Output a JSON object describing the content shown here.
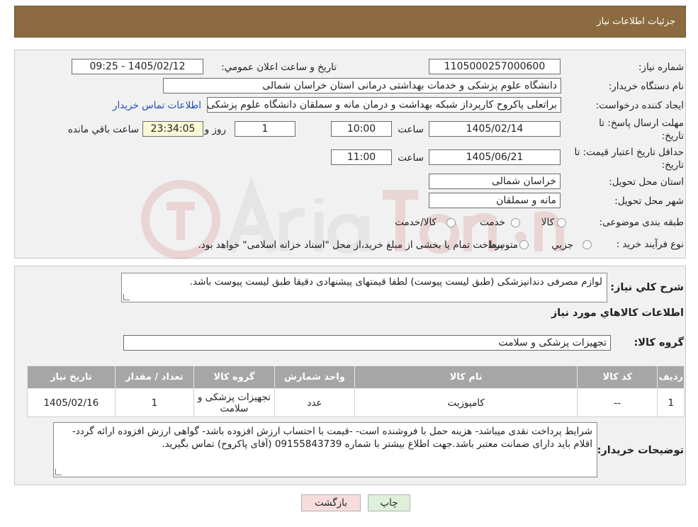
{
  "header": {
    "title": "جزئیات اطلاعات نیاز"
  },
  "form": {
    "need_number_label": "شماره نیاز:",
    "need_number": "1105000257000600",
    "announce_label": "تاریخ و ساعت اعلان عمومي:",
    "announce_value": "1405/02/12 - 09:25",
    "buyer_label": "نام دستگاه خریدار:",
    "buyer_value": "دانشگاه علوم پزشکی و خدمات بهداشتی درمانی استان خراسان شمالی",
    "creator_label": "ایجاد کننده درخواست:",
    "creator_value": "براتعلی پاکروح کارپرداز شبکه بهداشت و درمان مانه و سملقان دانشگاه علوم پزشکی",
    "contact_link": "اطلاعات تماس خریدار",
    "deadline_label_1": "مهلت ارسال پاسخ: تا",
    "deadline_label_2": "تاریخ:",
    "deadline_date": "1405/02/14",
    "time_label": "ساعت",
    "deadline_time": "10:00",
    "days_value": "1",
    "days_label": "روز و",
    "remaining_time": "23:34:05",
    "remaining_label": "ساعت باقي مانده",
    "validity_label_1": "حداقل تاریخ اعتبار قیمت: تا",
    "validity_label_2": "تاریخ:",
    "validity_date": "1405/06/21",
    "validity_time": "11:00",
    "province_label": "استان محل تحویل:",
    "province_value": "خراسان شمالی",
    "city_label": "شهر محل تحویل:",
    "city_value": "مانه و سملقان",
    "category_label": "طبقه بندی موضوعی:",
    "category_options": [
      "کالا",
      "خدمت",
      "کالا/خدمت"
    ],
    "process_label": "نوع فرآیند خرید :",
    "process_options": [
      "جزیي",
      "متوسط"
    ],
    "process_note": "پرداخت تمام یا بخشی از مبلغ خرید،از محل \"اسناد خزانه اسلامی\" خواهد بود."
  },
  "details": {
    "summary_label": "شرح کلي نیاز:",
    "summary_value": "لوازم مصرفی دندانپزشکی (طبق لیست پیوست) لطفا قیمتهای پیشنهادی دقیقا طبق لیست پیوست باشد.",
    "goods_info_title": "اطلاعات کالاهاي مورد نیاز",
    "goods_group_label": "گروه کالا:",
    "goods_group_value": "تجهیزات پزشکی و سلامت",
    "table": {
      "headers": [
        "ردیف",
        "کد کالا",
        "نام کالا",
        "واحد شمارش",
        "گروه کالا",
        "تعداد / مقدار",
        "تاریخ نیاز"
      ],
      "rows": [
        [
          "1",
          "--",
          "کامپوزیت",
          "عدد",
          "تجهیزات پزشکی و سلامت",
          "1",
          "1405/02/16"
        ]
      ]
    },
    "buyer_notes_label": "توضیحات خریدار:",
    "buyer_notes_value": "شرایط پرداخت نقدی میباشد- هزینه حمل با فروشنده است- -قیمت با احتساب ارزش افزوده  باشد- گواهی ارزش افزوده ارائه گردد-اقلام باید دارای ضمانت معتبر باشد.جهت اطلاع بیشتر با شماره 09155843739 (آقای پاکروح) تماس بگیرید."
  },
  "buttons": {
    "print": "چاپ",
    "back": "بازگشت"
  },
  "colors": {
    "header": "#8b6b3f",
    "table_header": "#a6a6a6",
    "link": "#1f4fb4"
  }
}
